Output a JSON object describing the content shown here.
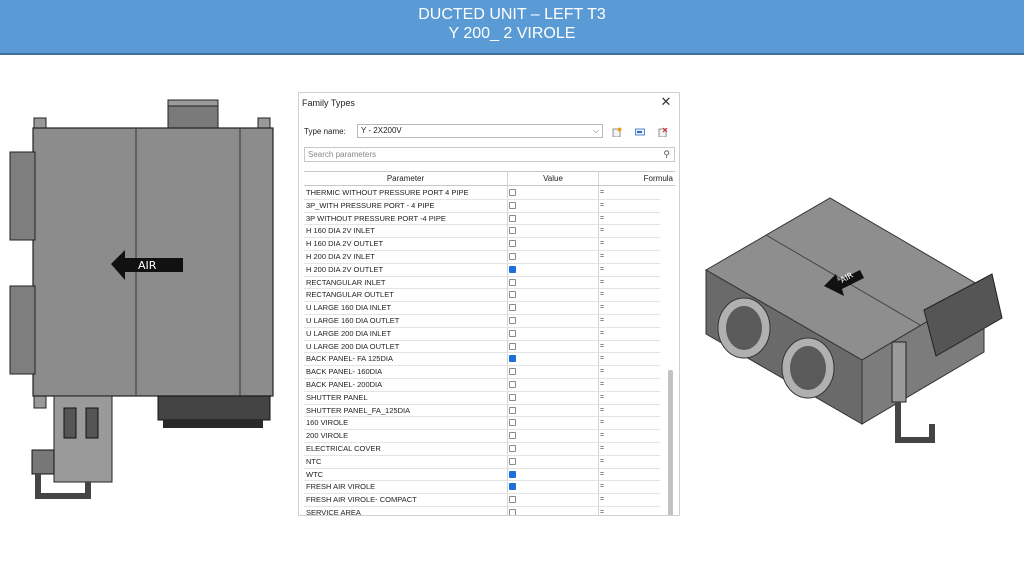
{
  "banner": {
    "line1": "DUCTED UNIT – LEFT T3",
    "line2": "Y 200_ 2 VIROLE"
  },
  "left_drawing": {
    "arrow_label": "AIR"
  },
  "right_drawing": {
    "arrow_label": "AIR"
  },
  "dialog": {
    "title": "Family Types",
    "close_glyph": "✕",
    "type_name_label": "Type name:",
    "type_name_value": "Y - 2X200V",
    "search_placeholder": "Search parameters",
    "columns": {
      "parameter": "Parameter",
      "value": "Value",
      "formula": "Formula"
    },
    "rows": [
      {
        "name": "THERMIC WITHOUT PRESSURE PORT  4 PIPE",
        "checked": false,
        "formula": "="
      },
      {
        "name": "3P_WITH PRESSURE PORT - 4 PIPE",
        "checked": false,
        "formula": "="
      },
      {
        "name": "3P WITHOUT PRESSURE PORT -4  PIPE",
        "checked": false,
        "formula": "="
      },
      {
        "name": "H 160 DIA 2V INLET",
        "checked": false,
        "formula": "="
      },
      {
        "name": "H 160 DIA 2V OUTLET",
        "checked": false,
        "formula": "="
      },
      {
        "name": "H 200 DIA 2V INLET",
        "checked": false,
        "formula": "="
      },
      {
        "name": "H 200 DIA 2V OUTLET",
        "checked": true,
        "formula": "="
      },
      {
        "name": "RECTANGULAR INLET",
        "checked": false,
        "formula": "="
      },
      {
        "name": "RECTANGULAR  OUTLET",
        "checked": false,
        "formula": "="
      },
      {
        "name": "U LARGE 160 DIA INLET",
        "checked": false,
        "formula": "="
      },
      {
        "name": "U LARGE 160 DIA OUTLET",
        "checked": false,
        "formula": "="
      },
      {
        "name": "U LARGE 200 DIA INLET",
        "checked": false,
        "formula": "="
      },
      {
        "name": "U LARGE 200 DIA OUTLET",
        "checked": false,
        "formula": "="
      },
      {
        "name": "BACK PANEL- FA 125DIA",
        "checked": true,
        "formula": "="
      },
      {
        "name": "BACK PANEL- 160DIA",
        "checked": false,
        "formula": "="
      },
      {
        "name": "BACK PANEL- 200DIA",
        "checked": false,
        "formula": "="
      },
      {
        "name": "SHUTTER PANEL",
        "checked": false,
        "formula": "="
      },
      {
        "name": "SHUTTER PANEL_FA_125DIA",
        "checked": false,
        "formula": "="
      },
      {
        "name": "160 VIROLE",
        "checked": false,
        "formula": "="
      },
      {
        "name": "200 VIROLE",
        "checked": false,
        "formula": "="
      },
      {
        "name": "ELECTRICAL COVER",
        "checked": false,
        "formula": "="
      },
      {
        "name": "NTC",
        "checked": false,
        "formula": "="
      },
      {
        "name": "WTC",
        "checked": true,
        "formula": "="
      },
      {
        "name": "FRESH AIR VIROLE",
        "checked": true,
        "formula": "="
      },
      {
        "name": "FRESH AIR VIROLE- COMPACT",
        "checked": false,
        "formula": "="
      },
      {
        "name": "SERVICE AREA",
        "checked": false,
        "formula": "="
      }
    ],
    "icons": [
      "new-type-icon",
      "rename-type-icon",
      "delete-type-icon",
      "search-icon",
      "close-icon"
    ],
    "accent_color": "#1e6fd9"
  },
  "colors": {
    "banner": "#5b9bd5",
    "unit_body": "#8a8a8a",
    "unit_dark": "#3c3c3c"
  }
}
